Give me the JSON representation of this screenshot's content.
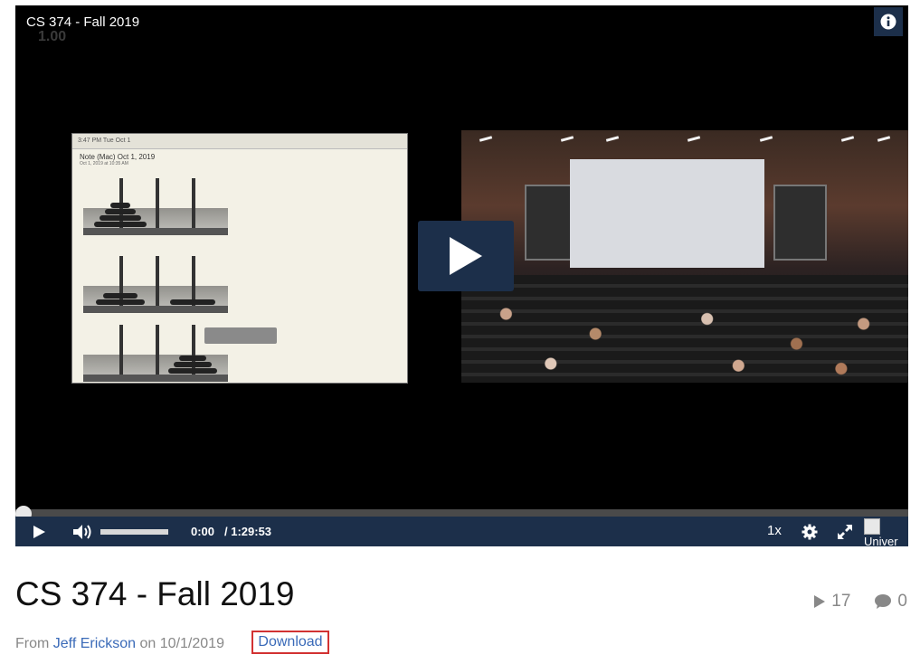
{
  "player": {
    "title": "CS 374 - Fall 2019",
    "speed_overlay": "1.00",
    "slide": {
      "toolbar_text": "3:47 PM  Tue Oct 1",
      "note_title": "Note (Mac) Oct 1, 2019",
      "note_date": "Oct 1, 2019 at 10:35 AM"
    },
    "controls": {
      "current_time": "0:00",
      "duration": "/ 1:29:53",
      "speed": "1x",
      "logo_alt": "Univer",
      "progress": 0
    },
    "icons": {
      "info": "info-icon",
      "big_play": "play-icon",
      "play": "play-icon",
      "volume": "volume-icon",
      "settings": "gear-icon",
      "fullscreen": "fullscreen-icon"
    },
    "colors": {
      "control_bar": "#1c2f4a",
      "link": "#3a6ab8",
      "highlight_border": "#d23232"
    }
  },
  "entry": {
    "title": "CS 374 - Fall 2019",
    "plays": "17",
    "comments": "0",
    "from_label": "From",
    "author": "Jeff Erickson",
    "on_label": "on",
    "date": "10/1/2019",
    "download_label": "Download"
  }
}
